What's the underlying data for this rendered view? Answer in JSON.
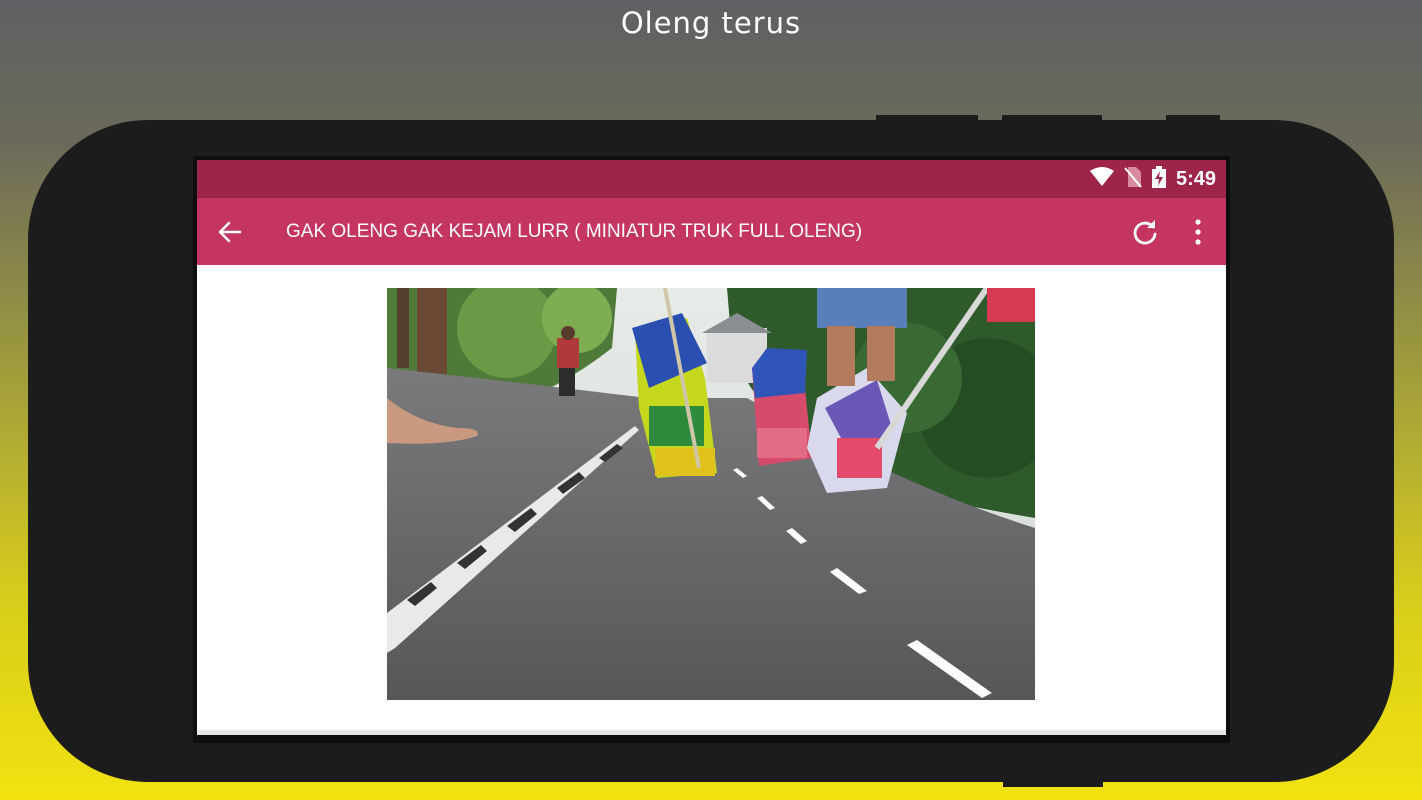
{
  "header": {
    "caption": "Oleng terus"
  },
  "status_bar": {
    "time": "5:49",
    "icons": [
      "wifi-icon",
      "no-sim-icon",
      "battery-charging-icon"
    ],
    "color": "#9e2449"
  },
  "app_bar": {
    "title": "GAK OLENG GAK KEJAM LURR ( MINIATUR TRUK FULL OLENG)",
    "color": "#c53562",
    "actions": [
      "back-arrow-icon",
      "refresh-icon",
      "more-vert-icon"
    ]
  },
  "video": {
    "thumbnail": "miniature-trucks-on-road"
  }
}
